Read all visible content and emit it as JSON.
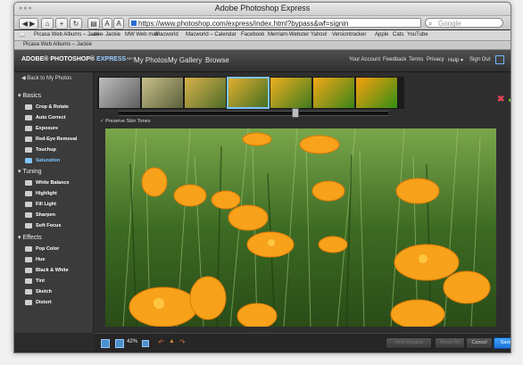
{
  "browser": {
    "title": "Adobe Photoshop Express",
    "url": "https://www.photoshop.com/express/index.html?bypass&wf=signin",
    "search_placeholder": "Google",
    "bookmarks": [
      "Picasa Web Albums – Jackie",
      "...ex – Jackie",
      "MW Web mail",
      "Macworld",
      "Macworld – Calendar",
      "Facebook",
      "Merriam-Webster",
      "Yahoo!",
      "Versiontracker",
      "Apple",
      "Cats",
      "YouTube"
    ],
    "tab": "Picasa Web Albums – Jackie",
    "font_size_small": "A",
    "font_size_large": "A"
  },
  "app": {
    "logo": {
      "brand": "ADOBE® PHOTOSHOP®",
      "product": "EXPRESS",
      "badge": "BETA"
    },
    "nav": [
      "My Photos",
      "My Gallery",
      "Browse"
    ],
    "right_nav": [
      "Your Account",
      "Feedback",
      "Terms",
      "Privacy",
      "Help ▾",
      "Sign Out"
    ]
  },
  "sidebar": {
    "back": "Back to My Photos",
    "sections": [
      {
        "title": "Basics",
        "items": [
          "Crop & Rotate",
          "Auto Correct",
          "Exposure",
          "Red-Eye Removal",
          "Touchup",
          "Saturation"
        ]
      },
      {
        "title": "Tuning",
        "items": [
          "White Balance",
          "Highlight",
          "Fill Light",
          "Sharpen",
          "Soft Focus"
        ]
      },
      {
        "title": "Effects",
        "items": [
          "Pop Color",
          "Hue",
          "Black & White",
          "Tint",
          "Sketch",
          "Distort"
        ]
      }
    ],
    "active_item": "Saturation"
  },
  "editor": {
    "preserve_skin_tones": "Preserve Skin Tones",
    "selected_thumbnail": 3,
    "saturation_level": 0.72
  },
  "bottom": {
    "zoom": "42%",
    "buttons": {
      "view_original": "View Original",
      "reset_all": "Reset All",
      "cancel": "Cancel",
      "save": "Save"
    }
  },
  "colors": {
    "accent": "#3ea3ff",
    "apply_green": "#6bd02a",
    "cancel_red": "#e0445a",
    "flower_orange": "#f7a21a"
  }
}
